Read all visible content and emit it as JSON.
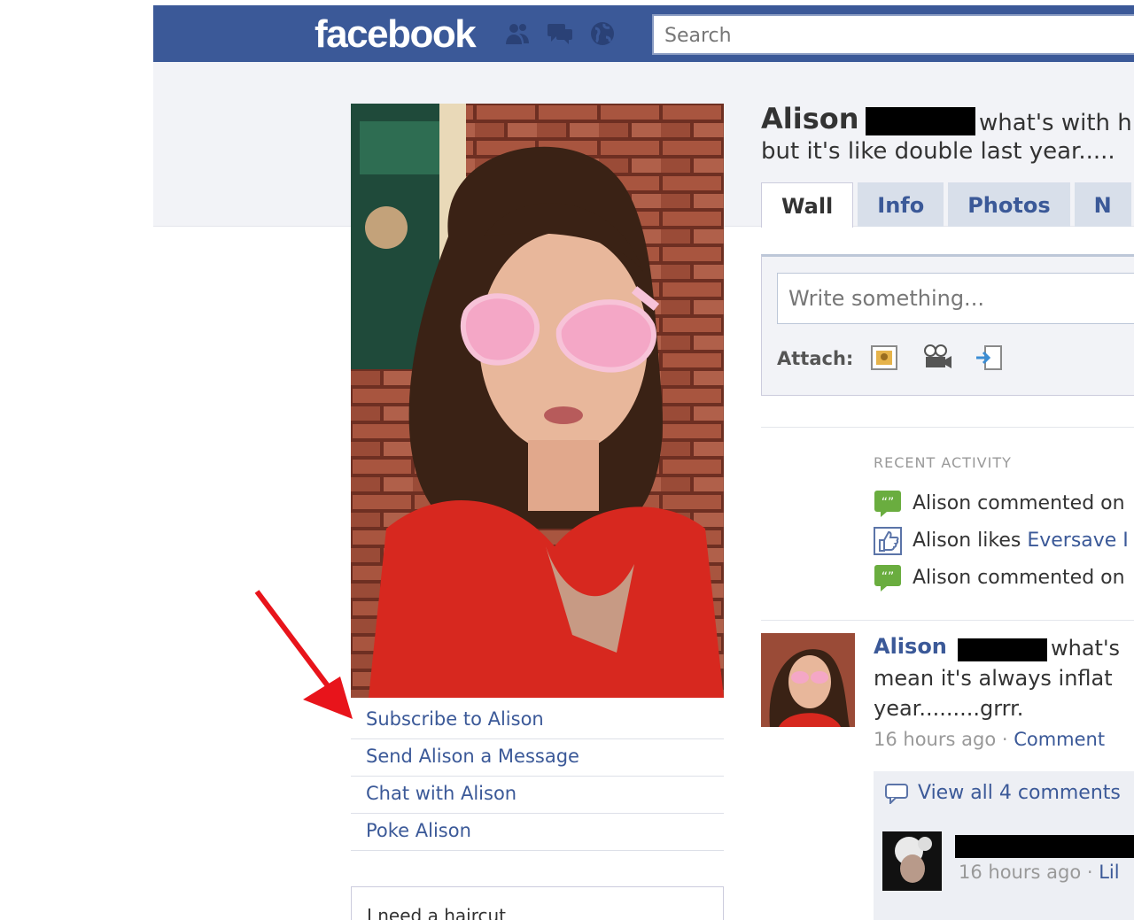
{
  "header": {
    "logo": "facebook",
    "search_placeholder": "Search",
    "jewels": [
      "friends-icon",
      "messages-icon",
      "notifications-icon"
    ]
  },
  "profile": {
    "name": "Alison",
    "status_part1": "what's with h",
    "status_part2": "but it's like double last year.....",
    "tabs": [
      {
        "label": "Wall",
        "active": true
      },
      {
        "label": "Info",
        "active": false
      },
      {
        "label": "Photos",
        "active": false
      },
      {
        "label": "N",
        "active": false
      }
    ]
  },
  "actions": {
    "subscribe": "Subscribe to Alison",
    "message": "Send Alison a Message",
    "chat": "Chat with Alison",
    "poke": "Poke Alison"
  },
  "box_text": "I need a haircut",
  "composer": {
    "placeholder": "Write something...",
    "attach_label": "Attach:",
    "attach_icons": [
      "photo-icon",
      "video-icon",
      "link-icon"
    ]
  },
  "recent_activity": {
    "heading": "RECENT ACTIVITY",
    "items": [
      {
        "icon": "comment-icon",
        "text": "Alison commented on",
        "link": ""
      },
      {
        "icon": "like-icon",
        "text": "Alison likes ",
        "link": "Eversave I"
      },
      {
        "icon": "comment-icon",
        "text": "Alison commented on",
        "link": ""
      }
    ]
  },
  "post": {
    "author": "Alison",
    "line1": "what's",
    "line2": "mean it's always inflat",
    "line3": "year.........grrr.",
    "time": "16 hours ago",
    "separator": " · ",
    "comment_link": "Comment",
    "view_all": "View all 4 comments",
    "comment_time": "16 hours ago",
    "comment_link2": "Lil"
  },
  "colors": {
    "brand": "#3b5998",
    "annotation_arrow": "#e8141b"
  }
}
